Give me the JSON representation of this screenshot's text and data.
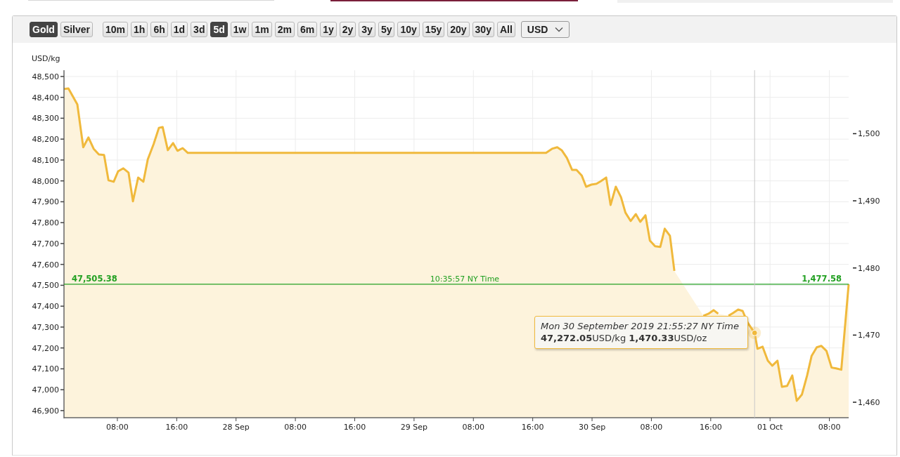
{
  "toolbar": {
    "metals": [
      {
        "label": "Gold",
        "selected": true
      },
      {
        "label": "Silver",
        "selected": false
      }
    ],
    "ranges": [
      {
        "label": "10m",
        "selected": false
      },
      {
        "label": "1h",
        "selected": false
      },
      {
        "label": "6h",
        "selected": false
      },
      {
        "label": "1d",
        "selected": false
      },
      {
        "label": "3d",
        "selected": false
      },
      {
        "label": "5d",
        "selected": true
      },
      {
        "label": "1w",
        "selected": false
      },
      {
        "label": "1m",
        "selected": false
      },
      {
        "label": "2m",
        "selected": false
      },
      {
        "label": "6m",
        "selected": false
      },
      {
        "label": "1y",
        "selected": false
      },
      {
        "label": "2y",
        "selected": false
      },
      {
        "label": "3y",
        "selected": false
      },
      {
        "label": "5y",
        "selected": false
      },
      {
        "label": "10y",
        "selected": false
      },
      {
        "label": "15y",
        "selected": false
      },
      {
        "label": "20y",
        "selected": false
      },
      {
        "label": "30y",
        "selected": false
      },
      {
        "label": "All",
        "selected": false
      }
    ],
    "currency": {
      "value": "USD"
    }
  },
  "chart": {
    "current_price": {
      "time": "10:35:57 NY Time",
      "value_oz": "1,477.58"
    },
    "right_axis": {
      "ticks": [
        "1,500",
        "1,490",
        "1,480",
        "1,470",
        "1,460"
      ]
    },
    "chart_data": {
      "type": "area",
      "ylabel": "USD/kg",
      "grid": true,
      "xlim": [
        "2019-09-27 00:48",
        "2019-10-01 10:36"
      ],
      "ylim": [
        46866,
        48530
      ],
      "xticks": [
        {
          "value": "2019-09-27 08:00",
          "label": "08:00"
        },
        {
          "value": "2019-09-27 16:00",
          "label": "16:00"
        },
        {
          "value": "2019-09-28 00:00",
          "label": "28 Sep"
        },
        {
          "value": "2019-09-28 08:00",
          "label": "08:00"
        },
        {
          "value": "2019-09-28 16:00",
          "label": "16:00"
        },
        {
          "value": "2019-09-29 00:00",
          "label": "29 Sep"
        },
        {
          "value": "2019-09-29 08:00",
          "label": "08:00"
        },
        {
          "value": "2019-09-29 16:00",
          "label": "16:00"
        },
        {
          "value": "2019-09-30 00:00",
          "label": "30 Sep"
        },
        {
          "value": "2019-09-30 08:00",
          "label": "08:00"
        },
        {
          "value": "2019-09-30 16:00",
          "label": "16:00"
        },
        {
          "value": "2019-10-01 00:00",
          "label": "01 Oct"
        },
        {
          "value": "2019-10-01 08:00",
          "label": "08:00"
        }
      ],
      "yticks": [
        {
          "value": 46900,
          "label": "46,900"
        },
        {
          "value": 47000,
          "label": "47,000"
        },
        {
          "value": 47100,
          "label": "47,100"
        },
        {
          "value": 47200,
          "label": "47,200"
        },
        {
          "value": 47300,
          "label": "47,300"
        },
        {
          "value": 47400,
          "label": "47,400"
        },
        {
          "value": 47500,
          "label": "47,500"
        },
        {
          "value": 47600,
          "label": "47,600"
        },
        {
          "value": 47700,
          "label": "47,700"
        },
        {
          "value": 47800,
          "label": "47,800"
        },
        {
          "value": 47900,
          "label": "47,900"
        },
        {
          "value": 48000,
          "label": "48,000"
        },
        {
          "value": 48100,
          "label": "48,100"
        },
        {
          "value": 48200,
          "label": "48,200"
        },
        {
          "value": 48300,
          "label": "48,300"
        },
        {
          "value": 48400,
          "label": "48,400"
        },
        {
          "value": 48500,
          "label": "48,500"
        }
      ],
      "x": [
        "2019-09-27 00:48",
        "2019-09-27 01:24",
        "2019-09-27 02:36",
        "2019-09-27 03:24",
        "2019-09-27 04:06",
        "2019-09-27 04:48",
        "2019-09-27 05:30",
        "2019-09-27 06:12",
        "2019-09-27 06:48",
        "2019-09-27 07:30",
        "2019-09-27 08:06",
        "2019-09-27 08:48",
        "2019-09-27 09:30",
        "2019-09-27 10:06",
        "2019-09-27 10:48",
        "2019-09-27 11:30",
        "2019-09-27 12:06",
        "2019-09-27 12:54",
        "2019-09-27 13:36",
        "2019-09-27 14:06",
        "2019-09-27 14:48",
        "2019-09-27 15:30",
        "2019-09-27 16:06",
        "2019-09-27 16:48",
        "2019-09-27 17:30",
        "2019-09-29 17:48",
        "2019-09-29 18:36",
        "2019-09-29 19:18",
        "2019-09-29 19:54",
        "2019-09-29 20:36",
        "2019-09-29 21:18",
        "2019-09-29 21:54",
        "2019-09-29 22:36",
        "2019-09-29 23:12",
        "2019-09-29 23:54",
        "2019-09-30 00:36",
        "2019-09-30 01:12",
        "2019-09-30 01:54",
        "2019-09-30 02:30",
        "2019-09-30 03:12",
        "2019-09-30 03:54",
        "2019-09-30 04:30",
        "2019-09-30 05:12",
        "2019-09-30 05:54",
        "2019-09-30 06:30",
        "2019-09-30 07:12",
        "2019-09-30 07:48",
        "2019-09-30 08:30",
        "2019-09-30 09:12",
        "2019-09-30 09:48",
        "2019-09-30 10:30",
        "2019-09-30 11:06",
        "2019-09-30 11:42",
        "2019-09-30 12:24",
        "2019-09-30 13:06",
        "2019-09-30 13:42",
        "2019-09-30 14:24",
        "2019-09-30 15:00",
        "2019-09-30 15:42",
        "2019-09-30 16:24",
        "2019-09-30 17:00",
        "2019-09-30 17:42",
        "2019-09-30 18:24",
        "2019-09-30 19:00",
        "2019-09-30 19:42",
        "2019-09-30 20:18",
        "2019-09-30 21:00",
        "2019-09-30 21:55",
        "2019-09-30 22:18",
        "2019-09-30 23:00",
        "2019-09-30 23:42",
        "2019-10-01 00:18",
        "2019-10-01 01:00",
        "2019-10-01 01:36",
        "2019-10-01 02:18",
        "2019-10-01 03:00",
        "2019-10-01 03:36",
        "2019-10-01 04:18",
        "2019-10-01 05:00",
        "2019-10-01 05:36",
        "2019-10-01 06:18",
        "2019-10-01 06:54",
        "2019-10-01 07:36",
        "2019-10-01 08:18",
        "2019-10-01 08:54",
        "2019-10-01 09:36",
        "2019-10-01 10:36"
      ],
      "series": [
        {
          "color": "#f0b93c",
          "values": [
            48440,
            48443,
            48366,
            48161,
            48208,
            48154,
            48127,
            48124,
            48003,
            47996,
            48046,
            48060,
            48040,
            47902,
            48016,
            47996,
            48103,
            48177,
            48254,
            48258,
            48147,
            48181,
            48144,
            48157,
            48134,
            48134,
            48154,
            48161,
            48147,
            48110,
            48053,
            48053,
            48026,
            47972,
            47982,
            47986,
            47999,
            48016,
            47885,
            47972,
            47922,
            47848,
            47808,
            47841,
            47804,
            47835,
            47714,
            47687,
            47684,
            47771,
            47737,
            47569,
            null,
            null,
            null,
            null,
            null,
            47354,
            47364,
            47381,
            47364,
            null,
            47354,
            47367,
            47384,
            47377,
            47320,
            47272,
            47196,
            47206,
            47139,
            47115,
            47139,
            47014,
            47018,
            47068,
            46947,
            46977,
            47068,
            47162,
            47203,
            47210,
            47186,
            47106,
            47102,
            47096,
            47505
          ]
        }
      ],
      "ref_lines": [
        {
          "axis": "y",
          "value": 47505.38,
          "label": "47,505.38"
        },
        {
          "axis": "x",
          "value": "2019-09-30 21:55"
        }
      ],
      "annotations": [
        {
          "x": "2019-09-30 21:55",
          "y": 47272.05,
          "text": "Mon 30 September 2019 21:55:27 NY Time"
        }
      ]
    },
    "tooltip": {
      "values": "**47,272.05**USD/kg **1,470.33**USD/oz"
    }
  }
}
